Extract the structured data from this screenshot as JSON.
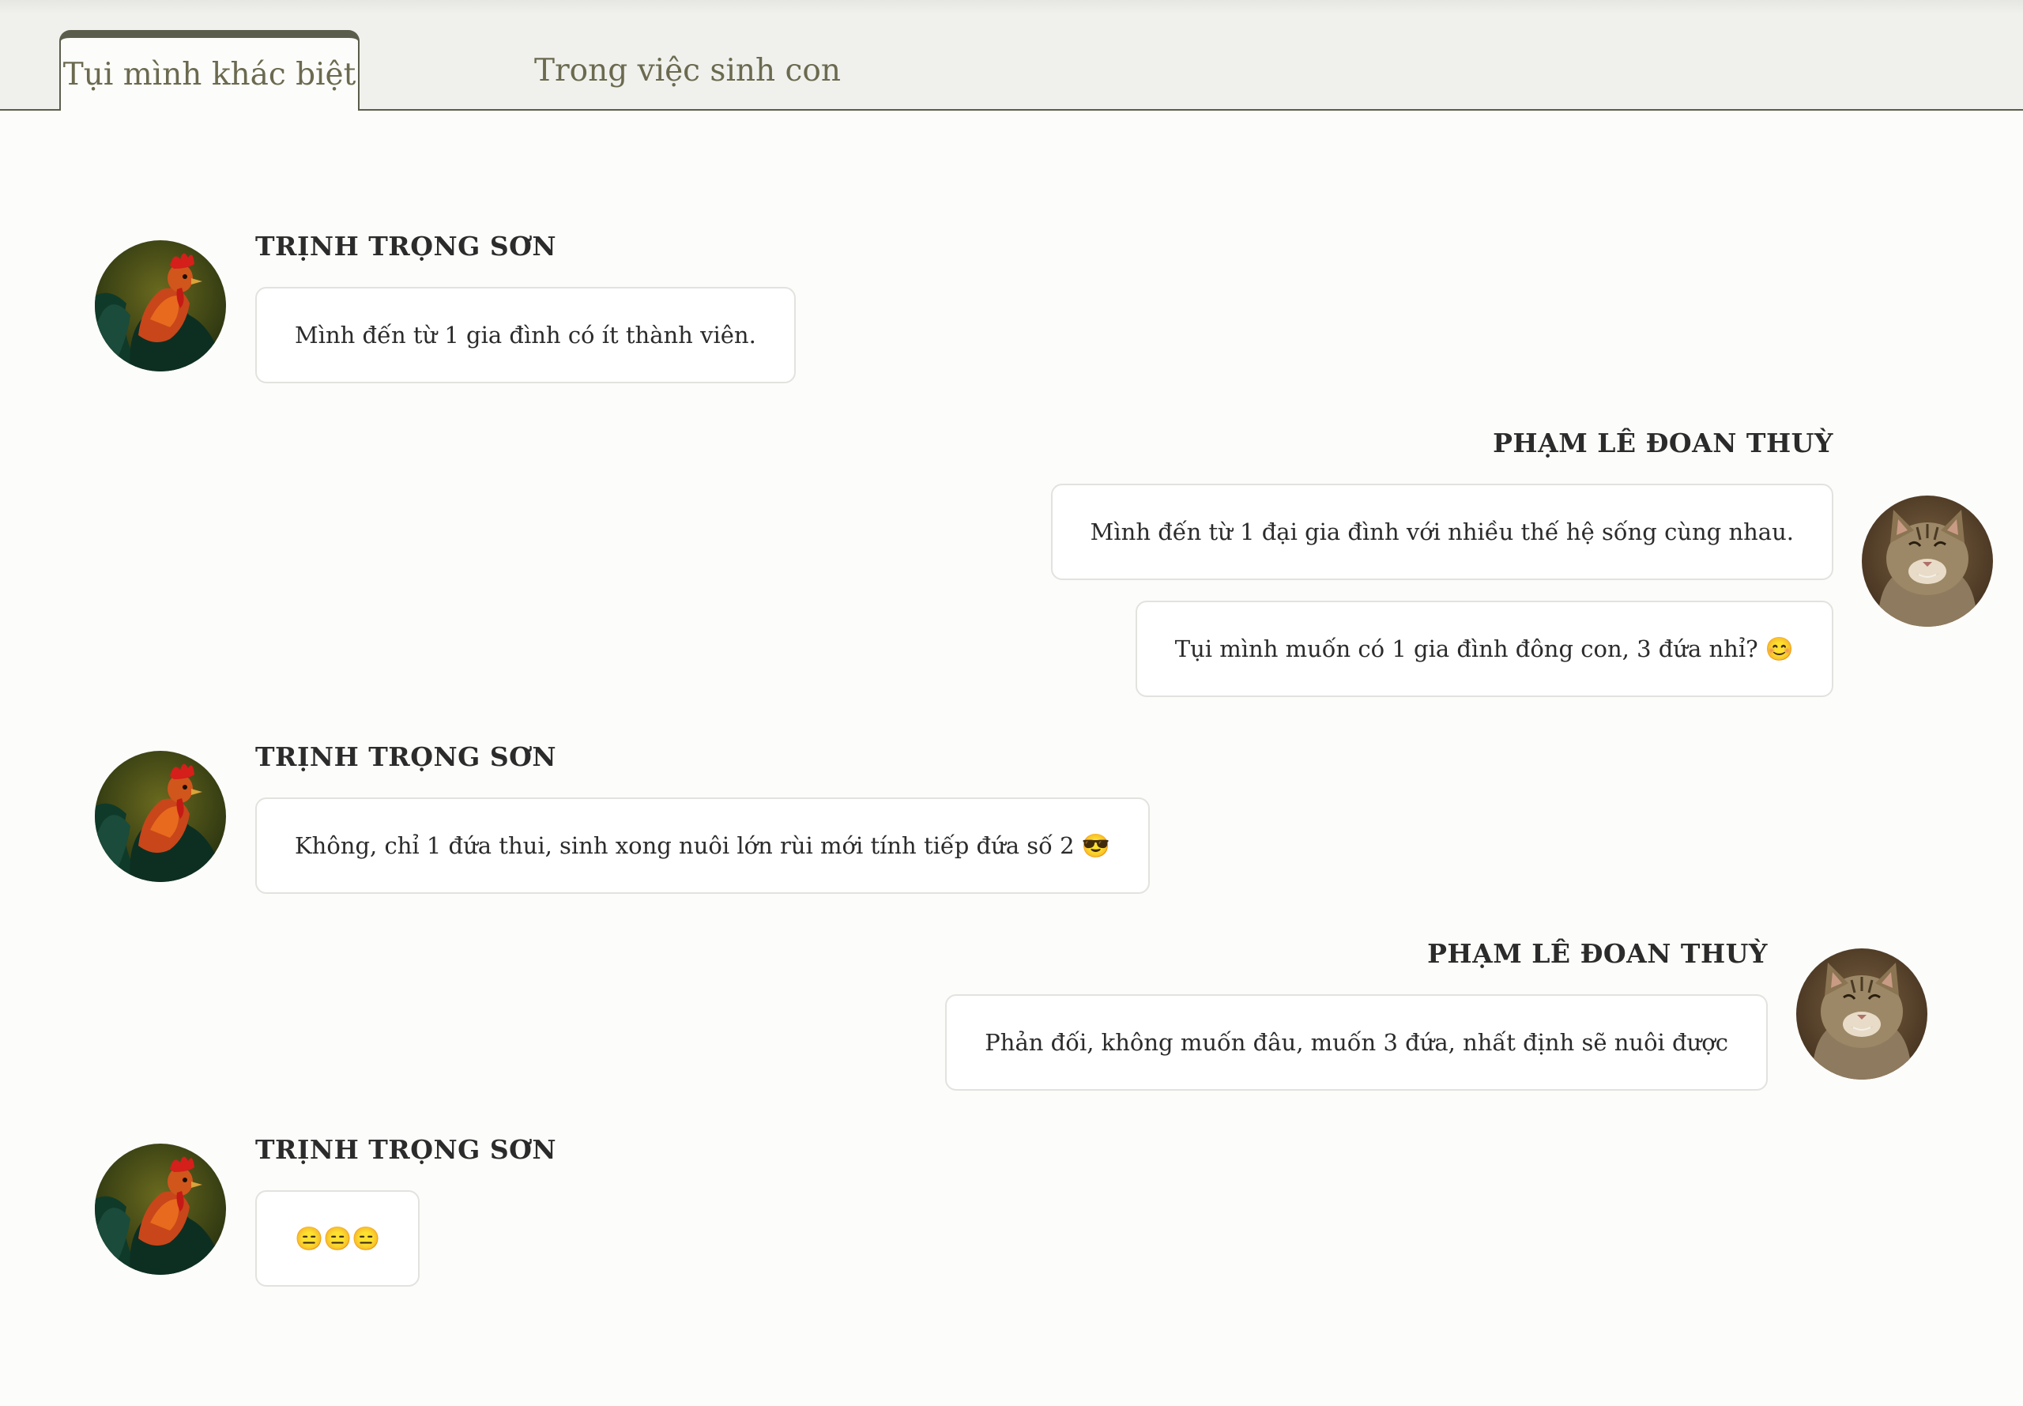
{
  "tabs": [
    {
      "label": "Tụi mình khác biệt",
      "active": true
    },
    {
      "label": "Trong việc sinh con",
      "active": false
    }
  ],
  "messages": [
    {
      "sender": "TRỊNH TRỌNG SƠN",
      "avatar": "rooster-avatar",
      "texts": [
        "Mình đến từ 1 gia đình có ít thành viên."
      ]
    },
    {
      "sender": "PHẠM LÊ ĐOAN THUỲ",
      "avatar": "cat-avatar",
      "texts": [
        "Mình đến từ 1 đại gia đình với nhiều thế hệ sống cùng nhau.",
        "Tụi mình muốn có 1 gia đình đông con, 3 đứa nhỉ? 😊"
      ]
    },
    {
      "sender": "TRỊNH TRỌNG SƠN",
      "avatar": "rooster-avatar",
      "texts": [
        "Không, chỉ 1 đứa thui, sinh xong nuôi lớn rùi mới tính tiếp đứa số 2 😎"
      ]
    },
    {
      "sender": "PHẠM LÊ ĐOAN THUỲ",
      "avatar": "cat-avatar",
      "texts": [
        "Phản đối, không muốn đâu, muốn 3 đứa, nhất định sẽ nuôi được"
      ]
    },
    {
      "sender": "TRỊNH TRỌNG SƠN",
      "avatar": "rooster-avatar",
      "texts": [
        "😑😑😑"
      ]
    }
  ]
}
